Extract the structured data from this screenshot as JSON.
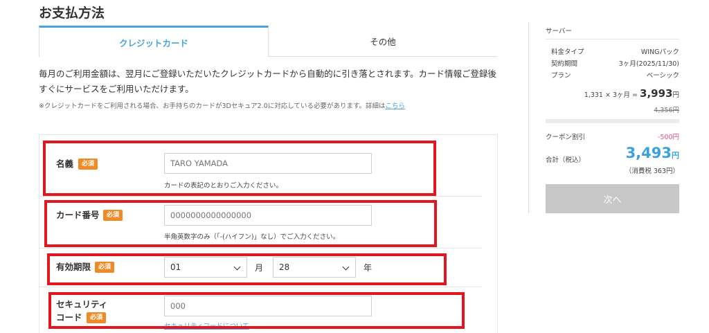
{
  "page": {
    "title": "お支払方法"
  },
  "tabs": [
    {
      "label": "クレジットカード",
      "active": true
    },
    {
      "label": "その他",
      "active": false
    }
  ],
  "description": {
    "line1": "毎月のご利用金額は、翌月にご登録いただいたクレジットカードから自動的に引き落とされます。カード情報ご登録後",
    "line2": "すぐにサービスをご利用いただけます。",
    "note": "※クレジットカードをご利用される場合、お手持ちのカードが3Dセキュア2.0に対応している必要があります。詳細は",
    "note_link": "こちら"
  },
  "form": {
    "required_badge": "必須",
    "name": {
      "label": "名義",
      "placeholder": "TARO YAMADA",
      "hint": "カードの表記のとおりご入力ください。"
    },
    "card_number": {
      "label": "カード番号",
      "placeholder": "0000000000000000",
      "hint": "半角英数字のみ（「-(ハイフン)」なし）でご入力ください。"
    },
    "expiry": {
      "label": "有効期限",
      "month_value": "01",
      "month_unit": "月",
      "year_value": "28",
      "year_unit": "年"
    },
    "security": {
      "label_line1": "セキュリティ",
      "label_line2": "コード",
      "placeholder": "000",
      "link": "セキュリティコードについて"
    }
  },
  "sidebar": {
    "title": "サーバー",
    "rows": [
      {
        "key": "料金タイプ",
        "value": "WINGパック"
      },
      {
        "key": "契約期間",
        "value": "3ヶ月(2025/11/30)"
      },
      {
        "key": "プラン",
        "value": "ベーシック"
      }
    ],
    "calc_prefix": "1,331 × 3ヶ月 =",
    "calc_amount": "3,993",
    "calc_unit": "円",
    "original_price": "4,356円",
    "coupon_label": "クーポン割引",
    "coupon_value": "-500円",
    "total_label": "合計（税込）",
    "total_amount": "3,493",
    "total_unit": "円",
    "tax_note": "（消費税 363円）",
    "next_button": "次へ"
  },
  "colors": {
    "accent": "#4aa3df",
    "required": "#f08a24",
    "highlight": "#e3161f",
    "coupon": "#e6517a",
    "button_disabled": "#c8c8c8"
  }
}
